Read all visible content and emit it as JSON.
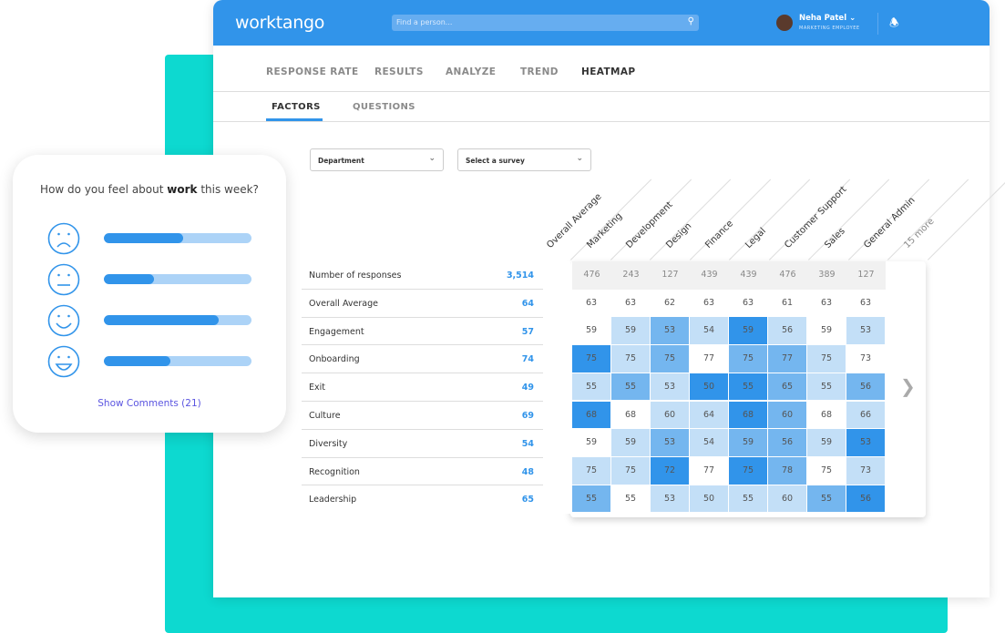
{
  "header": {
    "logo": "worktango",
    "search_placeholder": "Find a person...",
    "user_name": "Neha Patel",
    "user_role": "MARKETING EMPLOYEE"
  },
  "tabs": [
    "RESPONSE RATE",
    "RESULTS",
    "ANALYZE",
    "TREND",
    "HEATMAP"
  ],
  "active_tab": "HEATMAP",
  "subtabs": [
    "FACTORS",
    "QUESTIONS"
  ],
  "active_subtab": "FACTORS",
  "filters": {
    "department": "Department",
    "survey": "Select a survey"
  },
  "columns": [
    "Overall Average",
    "Marketing",
    "Development",
    "Design",
    "Finance",
    "Legal",
    "Customer Support",
    "Sales",
    "General Admin",
    "15 more"
  ],
  "rows": [
    {
      "name": "Number of responses",
      "total": "3,514"
    },
    {
      "name": "Overall Average",
      "total": "64"
    },
    {
      "name": "Engagement",
      "total": "57"
    },
    {
      "name": "Onboarding",
      "total": "74"
    },
    {
      "name": "Exit",
      "total": "49"
    },
    {
      "name": "Culture",
      "total": "69"
    },
    {
      "name": "Diversity",
      "total": "54"
    },
    {
      "name": "Recognition",
      "total": "48"
    },
    {
      "name": "Leadership",
      "total": "65"
    }
  ],
  "heatmap": {
    "counts": [
      "476",
      "243",
      "127",
      "439",
      "439",
      "476",
      "389",
      "127"
    ],
    "values": [
      [
        "63",
        "63",
        "62",
        "63",
        "63",
        "61",
        "63",
        "63"
      ],
      [
        "59",
        "59",
        "53",
        "54",
        "59",
        "56",
        "59",
        "53"
      ],
      [
        "75",
        "75",
        "75",
        "77",
        "75",
        "77",
        "75",
        "73"
      ],
      [
        "55",
        "55",
        "53",
        "50",
        "55",
        "65",
        "55",
        "56"
      ],
      [
        "68",
        "68",
        "60",
        "64",
        "68",
        "60",
        "68",
        "66"
      ],
      [
        "59",
        "59",
        "53",
        "54",
        "59",
        "56",
        "59",
        "53"
      ],
      [
        "75",
        "75",
        "72",
        "77",
        "75",
        "78",
        "75",
        "73"
      ],
      [
        "55",
        "55",
        "53",
        "50",
        "55",
        "60",
        "55",
        "56"
      ]
    ],
    "levels": [
      [
        0,
        0,
        0,
        0,
        0,
        0,
        0,
        0
      ],
      [
        0,
        1,
        2,
        1,
        3,
        1,
        0,
        1
      ],
      [
        3,
        1,
        2,
        0,
        2,
        2,
        1,
        0
      ],
      [
        1,
        2,
        1,
        3,
        3,
        2,
        1,
        2
      ],
      [
        3,
        0,
        1,
        1,
        3,
        2,
        0,
        1
      ],
      [
        0,
        1,
        2,
        1,
        2,
        2,
        1,
        3
      ],
      [
        1,
        1,
        3,
        0,
        3,
        2,
        0,
        1
      ],
      [
        2,
        0,
        1,
        1,
        1,
        1,
        2,
        3
      ]
    ],
    "level_colors": [
      "#ffffff",
      "#c3dff7",
      "#74b6ef",
      "#3194ea"
    ]
  },
  "survey_card": {
    "question_pre": "How do you feel about ",
    "question_bold": "work",
    "question_post": " this week?",
    "faces": [
      "sad-face-icon",
      "neutral-face-icon",
      "smile-face-icon",
      "grin-face-icon"
    ],
    "fractions": [
      0.54,
      0.34,
      0.78,
      0.45
    ],
    "show_comments": "Show Comments (21)"
  },
  "colors": {
    "brand": "#3194ea",
    "teal": "#0dd9d0",
    "link": "#5b55e0"
  }
}
